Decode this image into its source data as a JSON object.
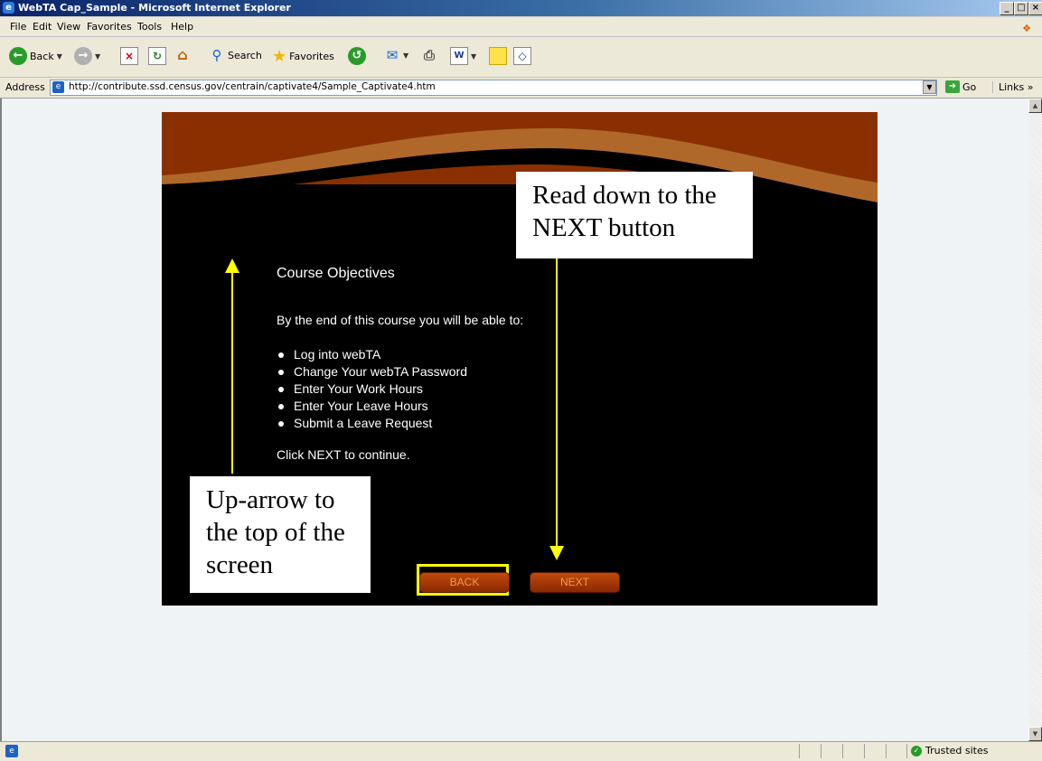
{
  "window": {
    "title": "WebTA Cap_Sample - Microsoft Internet Explorer"
  },
  "menu": [
    "File",
    "Edit",
    "View",
    "Favorites",
    "Tools",
    "Help"
  ],
  "toolbar": {
    "back_label": "Back",
    "search_label": "Search",
    "favorites_label": "Favorites",
    "word_letter": "W"
  },
  "address": {
    "label": "Address",
    "url": "http://contribute.ssd.census.gov/centrain/captivate4/Sample_Captivate4.htm",
    "go_label": "Go",
    "links_label": "Links"
  },
  "course": {
    "title": "Course Objectives",
    "intro": "By the end of this course you will be able to:",
    "objectives": [
      "Log into webTA",
      "Change Your webTA Password",
      "Enter Your Work Hours",
      "Enter Your Leave Hours",
      "Submit a Leave Request"
    ],
    "continue": "Click NEXT to continue.",
    "back_label": "BACK",
    "next_label": "NEXT"
  },
  "callouts": {
    "read_down": "Read down to the NEXT button",
    "up_arrow": "Up-arrow to the top of the screen"
  },
  "status": {
    "zone": "Trusted sites"
  },
  "colors": {
    "arrow": "#ffff00",
    "highlight": "#ffff00",
    "button": "#a33a06",
    "band": "#8a3000"
  }
}
